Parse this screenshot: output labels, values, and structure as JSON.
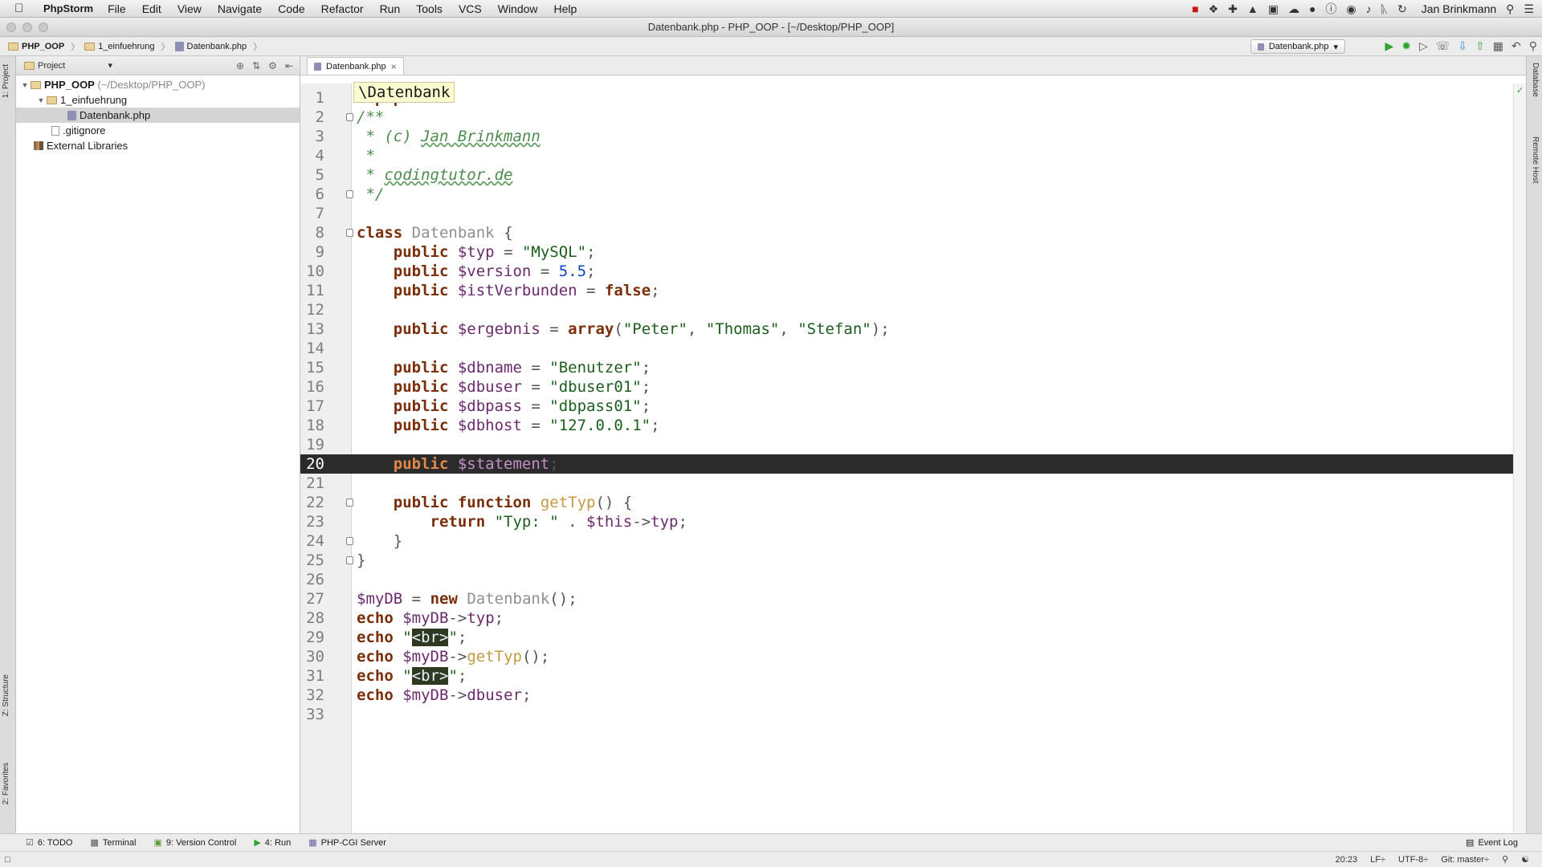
{
  "menubar": {
    "app": "PhpStorm",
    "items": [
      "File",
      "Edit",
      "View",
      "Navigate",
      "Code",
      "Refactor",
      "Run",
      "Tools",
      "VCS",
      "Window",
      "Help"
    ],
    "user": "Jan Brinkmann"
  },
  "window": {
    "title": "Datenbank.php - PHP_OOP - [~/Desktop/PHP_OOP]"
  },
  "breadcrumb": [
    "PHP_OOP",
    "1_einfuehrung",
    "Datenbank.php"
  ],
  "toolbar": {
    "run_config": "Datenbank.php"
  },
  "left_tools": {
    "project": "1: Project",
    "structure": "Z: Structure",
    "favorites": "2: Favorites"
  },
  "right_tools": {
    "database": "Database",
    "remote_host": "Remote Host"
  },
  "project_panel": {
    "selector": "Project",
    "tree": [
      {
        "label": "PHP_OOP",
        "suffix": "(~/Desktop/PHP_OOP)"
      },
      {
        "label": "1_einfuehrung"
      },
      {
        "label": "Datenbank.php"
      },
      {
        "label": ".gitignore"
      },
      {
        "label": "External Libraries"
      }
    ]
  },
  "editor": {
    "tab": "Datenbank.php",
    "class_label": "\\Datenbank",
    "current_line": 20
  },
  "bottom_tools": [
    "6: TODO",
    "Terminal",
    "9: Version Control",
    "4: Run",
    "PHP-CGI Server"
  ],
  "event_log": "Event Log",
  "status": {
    "position": "20:23",
    "line_sep": "LF÷",
    "encoding": "UTF-8÷",
    "vcs": "Git: master÷"
  },
  "code": [
    "<?php",
    "/**",
    " * (c) Jan Brinkmann",
    " *",
    " * codingtutor.de",
    " */",
    "",
    "class Datenbank {",
    "    public $typ = \"MySQL\";",
    "    public $version = 5.5;",
    "    public $istVerbunden = false;",
    "",
    "    public $ergebnis = array(\"Peter\", \"Thomas\", \"Stefan\");",
    "",
    "    public $dbname = \"Benutzer\";",
    "    public $dbuser = \"dbuser01\";",
    "    public $dbpass = \"dbpass01\";",
    "    public $dbhost = \"127.0.0.1\";",
    "",
    "    public $statement;",
    "",
    "    public function getTyp() {",
    "        return \"Typ: \" . $this->typ;",
    "    }",
    "}",
    "",
    "$myDB = new Datenbank();",
    "echo $myDB->typ;",
    "echo \"<br>\";",
    "echo $myDB->getTyp();",
    "echo \"<br>\";",
    "echo $myDB->dbuser;",
    ""
  ]
}
